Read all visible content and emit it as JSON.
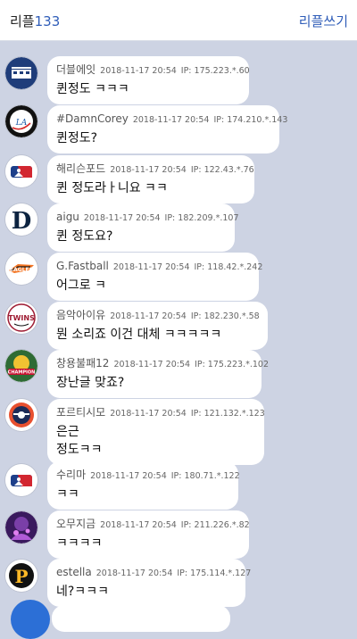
{
  "header": {
    "title": "리플",
    "count": "133",
    "write_label": "리플쓰기"
  },
  "comments": [
    {
      "nick": "더블에잇",
      "date": "2018-11-17 20:54",
      "ip": "IP: 175.223.*.60",
      "text": "퀸정도 ㅋㅋㅋ",
      "avatar": "navy-team-logo-icon"
    },
    {
      "nick": "#DamnCorey",
      "date": "2018-11-17 20:54",
      "ip": "IP: 174.210.*.143",
      "text": "퀸정도?",
      "avatar": "dodgers-logo-icon"
    },
    {
      "nick": "해리슨포드",
      "date": "2018-11-17 20:54",
      "ip": "IP: 122.43.*.76",
      "text": "퀸 정도라ㅏ니요 ㅋㅋ",
      "avatar": "mlb-logo-icon"
    },
    {
      "nick": "aigu",
      "date": "2018-11-17 20:54",
      "ip": "IP: 182.209.*.107",
      "text": "퀸 정도요?",
      "avatar": "tigers-d-logo-icon"
    },
    {
      "nick": "G.Fastball",
      "date": "2018-11-17 20:54",
      "ip": "IP: 118.42.*.242",
      "text": "어그로 ㅋ",
      "avatar": "eagles-logo-icon"
    },
    {
      "nick": "음악아이유",
      "date": "2018-11-17 20:54",
      "ip": "IP: 182.230.*.58",
      "text": "뭔 소리죠 이건 대체 ㅋㅋㅋㅋㅋ",
      "avatar": "twins-logo-icon"
    },
    {
      "nick": "창용불패12",
      "date": "2018-11-17 20:54",
      "ip": "IP: 175.223.*.102",
      "text": "장난글 맞죠?",
      "avatar": "tigers-champion-logo-icon"
    },
    {
      "nick": "포르티시모",
      "date": "2018-11-17 20:54",
      "ip": "IP: 121.132.*.123",
      "text": "은근\n정도ㅋㅋ",
      "avatar": "lotte-giants-logo-icon"
    },
    {
      "nick": "수리마",
      "date": "2018-11-17 20:54",
      "ip": "IP: 180.71.*.122",
      "text": "ㅋㅋ",
      "avatar": "mlb-logo-icon"
    },
    {
      "nick": "오무지금",
      "date": "2018-11-17 20:54",
      "ip": "IP: 211.226.*.82",
      "text": "ㅋㅋㅋㅋ",
      "avatar": "purple-photo-avatar-icon"
    },
    {
      "nick": "estella",
      "date": "2018-11-17 20:54",
      "ip": "IP: 175.114.*.127",
      "text": "네?ㅋㅋㅋ",
      "avatar": "pirates-p-logo-icon"
    }
  ],
  "colors": {
    "background": "#cdd3e3",
    "accent": "#2f5db8"
  }
}
